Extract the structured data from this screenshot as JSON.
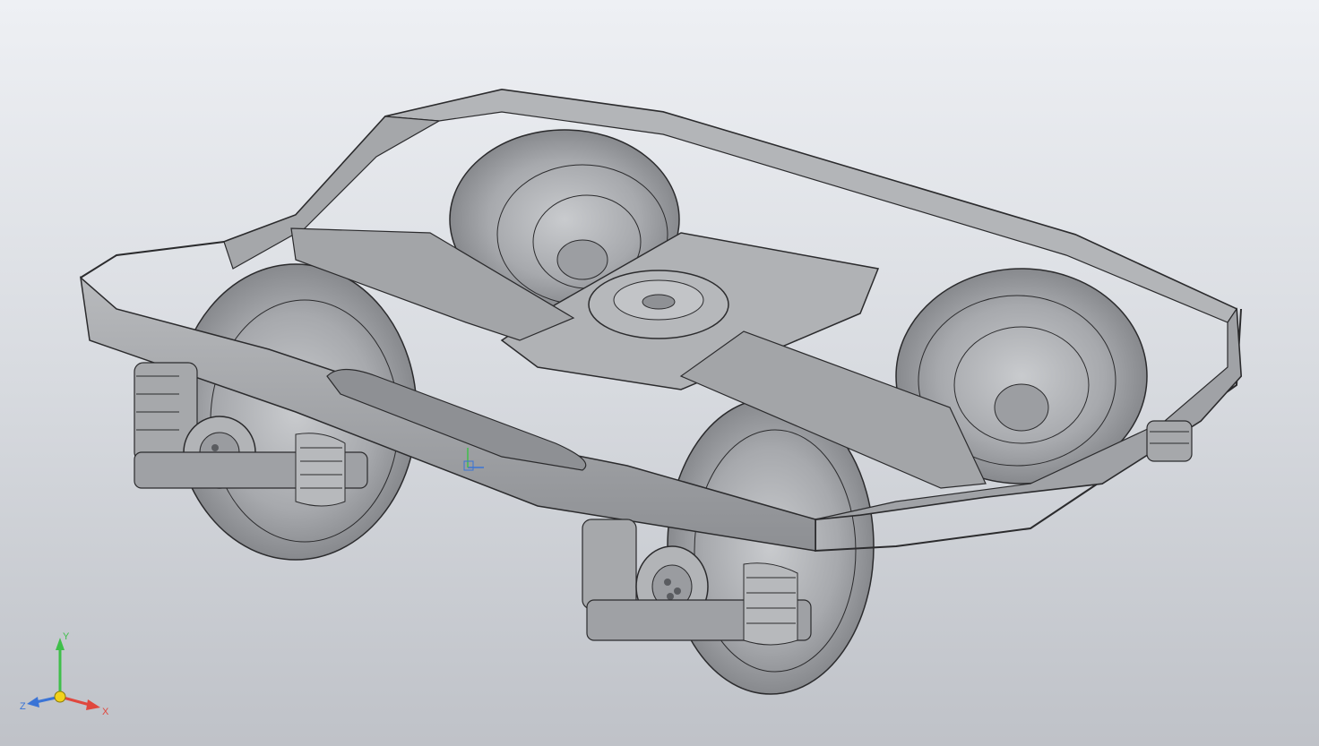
{
  "viewport": {
    "background_top": "#eef0f4",
    "background_bottom": "#bfc2c8",
    "model_fill": "#a9abaf",
    "model_edge": "#2b2b2d"
  },
  "triad": {
    "x_label": "X",
    "y_label": "Y",
    "z_label": "Z",
    "x_color": "#e0473d",
    "y_color": "#3fbf4a",
    "z_color": "#3a74d6",
    "origin_color": "#f2d21b"
  },
  "model": {
    "icon": "bogie-3d-model"
  }
}
